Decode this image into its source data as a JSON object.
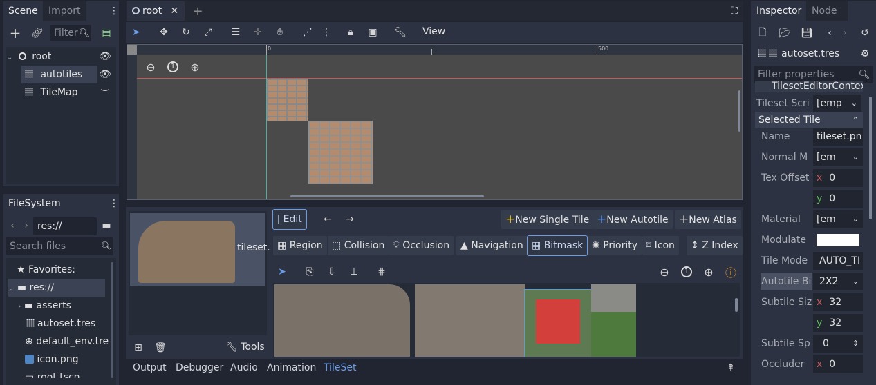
{
  "scene_dock": {
    "tabs": [
      "Scene",
      "Import"
    ],
    "filter_placeholder": "Filter",
    "tree": [
      {
        "label": "root",
        "icon": "node-circle-icon"
      },
      {
        "label": "autotiles",
        "icon": "tileset-grid-icon"
      },
      {
        "label": "TileMap",
        "icon": "tileset-grid-icon"
      }
    ]
  },
  "filesystem_dock": {
    "tab": "FileSystem",
    "path": "res://",
    "search_placeholder": "Search files",
    "items": [
      {
        "label": "Favorites:",
        "icon": "star-icon"
      },
      {
        "label": "res://",
        "icon": "folder-icon"
      },
      {
        "label": "asserts",
        "icon": "folder-icon"
      },
      {
        "label": "autoset.tres",
        "icon": "tileset-grid-icon"
      },
      {
        "label": "default_env.tre",
        "icon": "globe-icon"
      },
      {
        "label": "icon.png",
        "icon": "image-icon"
      },
      {
        "label": "root.tscn",
        "icon": "scene-icon"
      }
    ]
  },
  "editor_tabs": {
    "scene_tab": "root"
  },
  "toolbar": {
    "view_menu": "View"
  },
  "viewport": {
    "ruler_labels": [
      "0",
      "500"
    ],
    "zoom_reset": "1"
  },
  "tileset_editor": {
    "texture_label": "tileset.",
    "edit_button": "Edit",
    "new_single_tile": "New Single Tile",
    "new_autotile": "New Autotile",
    "new_atlas": "New Atlas",
    "modes": [
      "Region",
      "Collision",
      "Occlusion",
      "Navigation",
      "Bitmask",
      "Priority",
      "Icon",
      "Z Index"
    ],
    "active_mode": "Bitmask",
    "tools_label": "Tools",
    "zoom_reset": "1"
  },
  "bottom_panel": {
    "tabs": [
      "Output",
      "Debugger",
      "Audio",
      "Animation",
      "TileSet"
    ],
    "active_tab": "TileSet"
  },
  "inspector": {
    "tabs": [
      "Inspector",
      "Node"
    ],
    "resource": "autoset.tres",
    "filter_placeholder": "Filter properties",
    "context_header": "TilesetEditorContext",
    "tileset_script_label": "Tileset Scri",
    "tileset_script_value": "[emp",
    "section": "Selected Tile",
    "props": {
      "name_label": "Name",
      "name_value": "tileset.pn",
      "normal_label": "Normal M",
      "normal_value": "[em",
      "tex_offset_label": "Tex Offset",
      "tex_offset_x": "0",
      "tex_offset_y": "0",
      "material_label": "Material",
      "material_value": "[em",
      "modulate_label": "Modulate",
      "tile_mode_label": "Tile Mode",
      "tile_mode_value": "AUTO_TI",
      "autotile_label": "Autotile Bi",
      "autotile_value": "2X2",
      "subtile_size_label": "Subtile Siz",
      "subtile_size_x": "32",
      "subtile_size_y": "32",
      "subtile_sp_label": "Subtile Sp",
      "subtile_sp_value": "0",
      "occluder_label": "Occluder",
      "occluder_x": "0"
    }
  },
  "colors": {
    "accent": "#699ce8",
    "bitmask_red": "#e03a3a",
    "modulate": "#ffffff"
  }
}
